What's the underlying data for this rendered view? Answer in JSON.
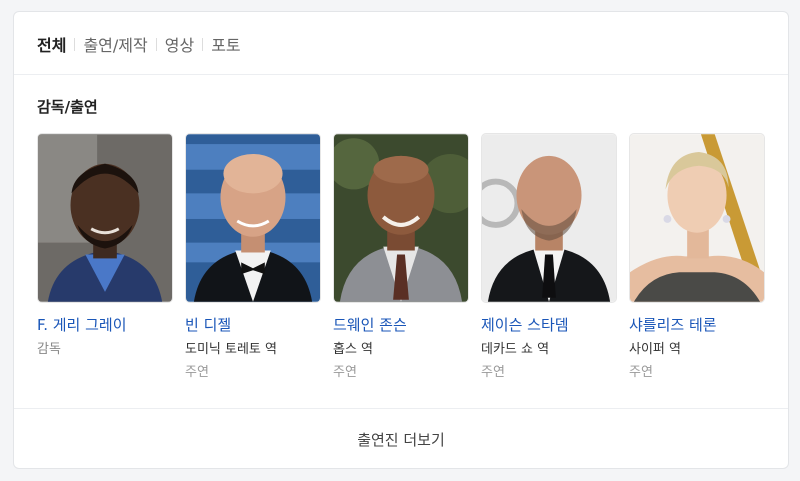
{
  "tabs": [
    {
      "label": "전체",
      "active": true
    },
    {
      "label": "출연/제작",
      "active": false
    },
    {
      "label": "영상",
      "active": false
    },
    {
      "label": "포토",
      "active": false
    }
  ],
  "section": {
    "title": "감독/출연"
  },
  "people": [
    {
      "name": "F. 게리 그레이",
      "role": "감독",
      "type": ""
    },
    {
      "name": "빈 디젤",
      "role": "도미닉 토레토 역",
      "type": "주연"
    },
    {
      "name": "드웨인 존슨",
      "role": "홉스 역",
      "type": "주연"
    },
    {
      "name": "제이슨 스타뎀",
      "role": "데카드 쇼 역",
      "type": "주연"
    },
    {
      "name": "샤를리즈 테론",
      "role": "사이퍼 역",
      "type": "주연"
    }
  ],
  "more_button": {
    "label": "출연진 더보기"
  },
  "colors": {
    "link": "#1a56b8",
    "text": "#222222",
    "muted": "#999999",
    "background": "#f4f5f7"
  }
}
